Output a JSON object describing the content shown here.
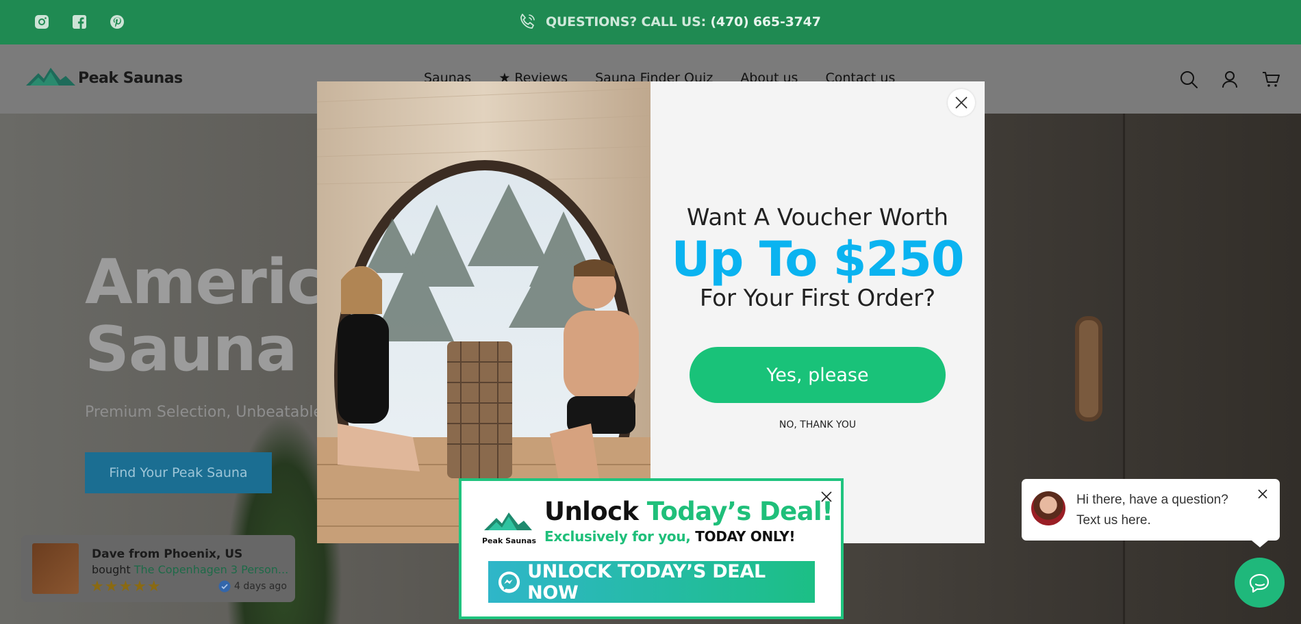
{
  "topbar": {
    "social": [
      "instagram-icon",
      "facebook-icon",
      "pinterest-icon"
    ],
    "phone_prefix": "QUESTIONS? CALL US: ",
    "phone_number": "(470) 665-3747"
  },
  "header": {
    "logo_text": "Peak Saunas",
    "nav": [
      "Saunas",
      "★ Reviews",
      "Sauna Finder Quiz",
      "About us",
      "Contact us"
    ],
    "icons": [
      "search-icon",
      "account-icon",
      "cart-icon"
    ]
  },
  "hero": {
    "title_line1": "America",
    "title_line2": "Sauna C",
    "subtitle": "Premium Selection, Unbeatable P",
    "button": "Find Your Peak Sauna"
  },
  "proof": {
    "name": "Dave from Phoenix, US",
    "bought_prefix": "bought ",
    "product": "The Copenhagen 3 Person...",
    "stars": "★★★★★",
    "rating": 5,
    "ago": "4 days ago"
  },
  "modal": {
    "line1": "Want A Voucher Worth",
    "line2": "Up To $250",
    "line3": "For Your First Order?",
    "yes": "Yes, please",
    "no": "NO, THANK YOU"
  },
  "deal": {
    "logo_text": "Peak Saunas",
    "h1_black": "Unlock ",
    "h1_green": "Today’s Deal!",
    "h2_green": "Exclusively for you, ",
    "h2_black": "TODAY ONLY!",
    "cta": "UNLOCK TODAY’S DEAL NOW"
  },
  "chat": {
    "message": "Hi there, have a question? Text us here."
  },
  "colors": {
    "topbar": "#1f8a52",
    "accent_blue": "#0ab3f0",
    "accent_green": "#19c279"
  }
}
